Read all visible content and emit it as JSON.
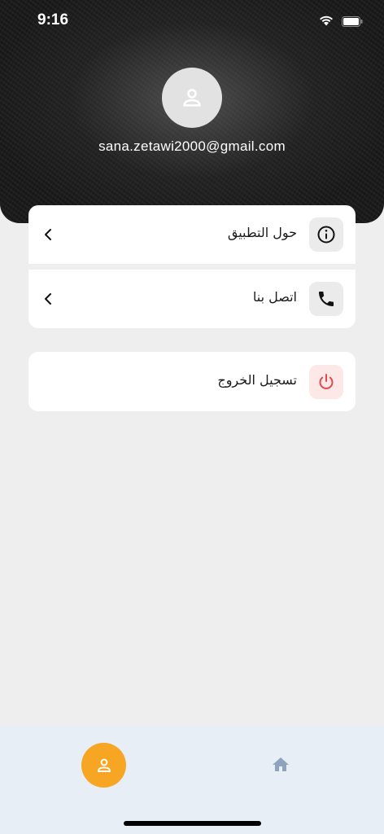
{
  "status_bar": {
    "time": "9:16"
  },
  "profile": {
    "email": "sana.zetawi2000@gmail.com"
  },
  "menu": {
    "about": {
      "label": "حول التطبيق",
      "icon": "info-icon"
    },
    "contact": {
      "label": "اتصل بنا",
      "icon": "phone-icon"
    },
    "logout": {
      "label": "تسجيل الخروج",
      "icon": "power-icon"
    }
  },
  "bottom_nav": {
    "items": [
      {
        "icon": "person-icon",
        "active": true
      },
      {
        "icon": "home-icon",
        "active": false
      }
    ]
  },
  "colors": {
    "accent": "#f6a623",
    "logout_icon": "#e5484d",
    "logout_icon_bg": "#fde8e8",
    "page_bg": "#eeeeee",
    "nav_bg": "#e8eef5",
    "home_icon": "#8fa3bf"
  }
}
